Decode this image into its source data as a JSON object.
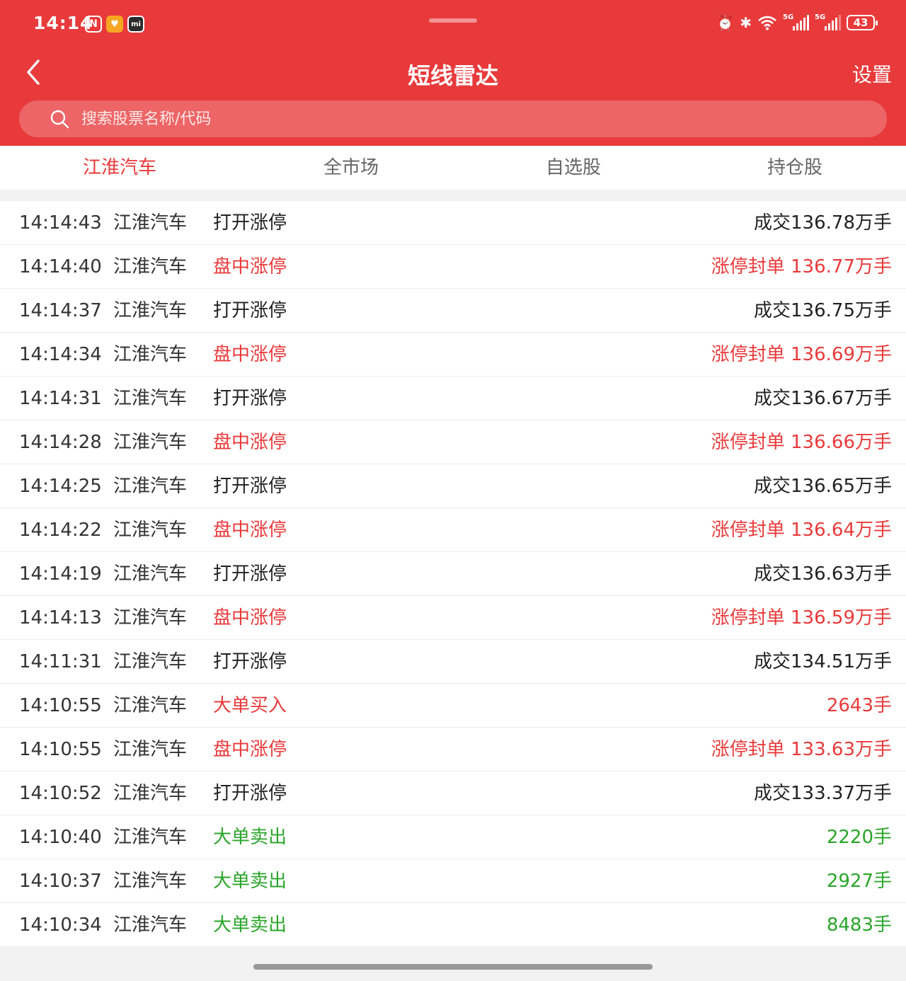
{
  "status_bar": {
    "time": "14:14",
    "battery": "43",
    "left_icons": [
      "nfc-icon",
      "shield-icon",
      "mi-icon"
    ],
    "right_icons": [
      "alarm-icon",
      "bluetooth-icon",
      "wifi-icon",
      "signal-5g-icon",
      "signal-5g-icon",
      "battery-icon"
    ]
  },
  "nav": {
    "title": "短线雷达",
    "settings_label": "设置"
  },
  "search": {
    "placeholder": "搜索股票名称/代码",
    "value": ""
  },
  "tabs": [
    {
      "label": "江淮汽车",
      "active": true
    },
    {
      "label": "全市场",
      "active": false
    },
    {
      "label": "自选股",
      "active": false
    },
    {
      "label": "持仓股",
      "active": false
    }
  ],
  "colors": {
    "brand": "#e83a3b",
    "up": "#e83a3b",
    "down": "#2aa52a",
    "neutral": "#222222"
  },
  "rows": [
    {
      "time": "14:14:43",
      "name": "江淮汽车",
      "event": "打开涨停",
      "detail": "成交136.78万手",
      "tone": "dark"
    },
    {
      "time": "14:14:40",
      "name": "江淮汽车",
      "event": "盘中涨停",
      "detail": "涨停封单 136.77万手",
      "tone": "red"
    },
    {
      "time": "14:14:37",
      "name": "江淮汽车",
      "event": "打开涨停",
      "detail": "成交136.75万手",
      "tone": "dark"
    },
    {
      "time": "14:14:34",
      "name": "江淮汽车",
      "event": "盘中涨停",
      "detail": "涨停封单 136.69万手",
      "tone": "red"
    },
    {
      "time": "14:14:31",
      "name": "江淮汽车",
      "event": "打开涨停",
      "detail": "成交136.67万手",
      "tone": "dark"
    },
    {
      "time": "14:14:28",
      "name": "江淮汽车",
      "event": "盘中涨停",
      "detail": "涨停封单 136.66万手",
      "tone": "red"
    },
    {
      "time": "14:14:25",
      "name": "江淮汽车",
      "event": "打开涨停",
      "detail": "成交136.65万手",
      "tone": "dark"
    },
    {
      "time": "14:14:22",
      "name": "江淮汽车",
      "event": "盘中涨停",
      "detail": "涨停封单 136.64万手",
      "tone": "red"
    },
    {
      "time": "14:14:19",
      "name": "江淮汽车",
      "event": "打开涨停",
      "detail": "成交136.63万手",
      "tone": "dark"
    },
    {
      "time": "14:14:13",
      "name": "江淮汽车",
      "event": "盘中涨停",
      "detail": "涨停封单 136.59万手",
      "tone": "red"
    },
    {
      "time": "14:11:31",
      "name": "江淮汽车",
      "event": "打开涨停",
      "detail": "成交134.51万手",
      "tone": "dark"
    },
    {
      "time": "14:10:55",
      "name": "江淮汽车",
      "event": "大单买入",
      "detail": "2643手",
      "tone": "red"
    },
    {
      "time": "14:10:55",
      "name": "江淮汽车",
      "event": "盘中涨停",
      "detail": "涨停封单 133.63万手",
      "tone": "red"
    },
    {
      "time": "14:10:52",
      "name": "江淮汽车",
      "event": "打开涨停",
      "detail": "成交133.37万手",
      "tone": "dark"
    },
    {
      "time": "14:10:40",
      "name": "江淮汽车",
      "event": "大单卖出",
      "detail": "2220手",
      "tone": "green"
    },
    {
      "time": "14:10:37",
      "name": "江淮汽车",
      "event": "大单卖出",
      "detail": "2927手",
      "tone": "green"
    },
    {
      "time": "14:10:34",
      "name": "江淮汽车",
      "event": "大单卖出",
      "detail": "8483手",
      "tone": "green"
    }
  ]
}
